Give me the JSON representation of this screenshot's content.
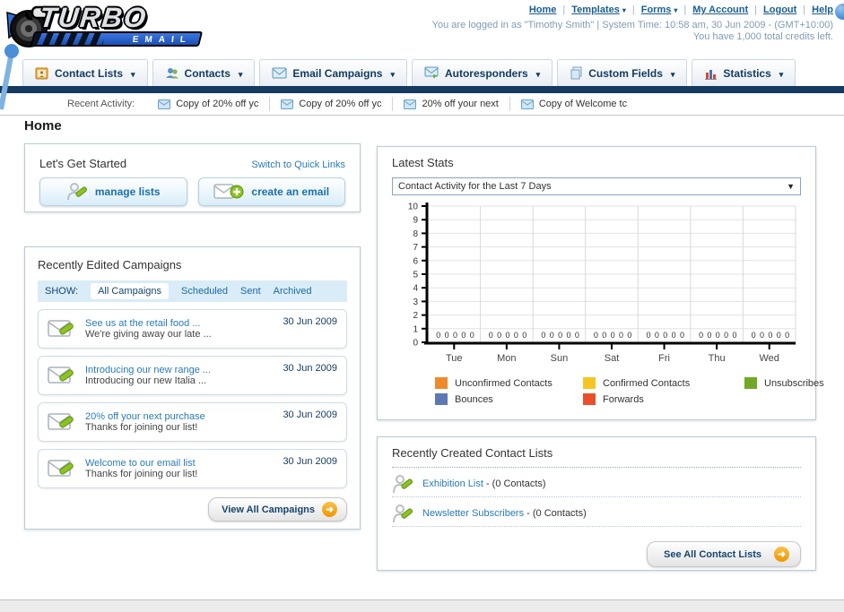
{
  "header": {
    "logo_title": "TURBO",
    "logo_subtitle": "EMAIL",
    "nav_links": [
      {
        "label": "Home",
        "dropdown": false
      },
      {
        "label": "Templates",
        "dropdown": true
      },
      {
        "label": "Forms",
        "dropdown": true
      },
      {
        "label": "My Account",
        "dropdown": false
      },
      {
        "label": "Logout",
        "dropdown": false
      },
      {
        "label": "Help",
        "dropdown": false
      }
    ],
    "login_line": "You are logged in as \"Timothy Smith\" | System Time: 10:58 am, 30 Jun 2009 - (GMT+10:00)",
    "credits_line": "You have 1,000 total credits left."
  },
  "tabs": [
    {
      "label": "Contact Lists"
    },
    {
      "label": "Contacts"
    },
    {
      "label": "Email Campaigns"
    },
    {
      "label": "Autoresponders"
    },
    {
      "label": "Custom Fields"
    },
    {
      "label": "Statistics"
    }
  ],
  "recent_activity": {
    "label": "Recent Activity:",
    "items": [
      {
        "title": "Copy of 20% off yc"
      },
      {
        "title": "Copy of 20% off yc"
      },
      {
        "title": "20% off your next"
      },
      {
        "title": "Copy of Welcome tc"
      }
    ]
  },
  "page": {
    "title": "Home"
  },
  "get_started": {
    "title": "Let's Get Started",
    "switch_link": "Switch to Quick Links",
    "manage_lists_label": "manage lists",
    "create_email_label": "create an email"
  },
  "campaigns": {
    "title": "Recently Edited Campaigns",
    "show_label": "SHOW:",
    "filters": [
      {
        "label": "All Campaigns",
        "selected": true
      },
      {
        "label": "Scheduled",
        "selected": false
      },
      {
        "label": "Sent",
        "selected": false
      },
      {
        "label": "Archived",
        "selected": false
      }
    ],
    "items": [
      {
        "title": "See us at the retail food ...",
        "subtitle": "We're giving away our late ...",
        "date": "30 Jun 2009"
      },
      {
        "title": "Introducing our new range ...",
        "subtitle": "Introducing our new Italia ...",
        "date": "30 Jun 2009"
      },
      {
        "title": "20% off your next purchase",
        "subtitle": "Thanks for joining our list!",
        "date": "30 Jun 2009"
      },
      {
        "title": "Welcome to our email list",
        "subtitle": "Thanks for joining our list!",
        "date": "30 Jun 2009"
      }
    ],
    "view_all_label": "View All Campaigns"
  },
  "stats": {
    "title": "Latest Stats",
    "dropdown_value": "Contact Activity for the Last 7 Days"
  },
  "chart_data": {
    "type": "bar",
    "title": "Contact Activity for the Last 7 Days",
    "categories": [
      "Tue",
      "Mon",
      "Sun",
      "Sat",
      "Fri",
      "Thu",
      "Wed"
    ],
    "series": [
      {
        "name": "Unconfirmed Contacts",
        "color": "#ef8a2a",
        "values": [
          0,
          0,
          0,
          0,
          0,
          0,
          0
        ]
      },
      {
        "name": "Confirmed Contacts",
        "color": "#f5c623",
        "values": [
          0,
          0,
          0,
          0,
          0,
          0,
          0
        ]
      },
      {
        "name": "Unsubscribes",
        "color": "#71a825",
        "values": [
          0,
          0,
          0,
          0,
          0,
          0,
          0
        ]
      },
      {
        "name": "Bounces",
        "color": "#5d79b2",
        "values": [
          0,
          0,
          0,
          0,
          0,
          0,
          0
        ]
      },
      {
        "name": "Forwards",
        "color": "#e8502a",
        "values": [
          0,
          0,
          0,
          0,
          0,
          0,
          0
        ]
      }
    ],
    "ylim": [
      0,
      10
    ],
    "yticks": [
      0,
      1,
      2,
      3,
      4,
      5,
      6,
      7,
      8,
      9,
      10
    ],
    "grid": true,
    "legend_position": "bottom",
    "value_labels_shown": true
  },
  "contact_lists": {
    "title": "Recently Created Contact Lists",
    "items": [
      {
        "name": "Exhibition List",
        "suffix": " - (0 Contacts)"
      },
      {
        "name": "Newsletter Subscribers",
        "suffix": " - (0 Contacts)"
      }
    ],
    "see_all_label": "See All Contact Lists"
  }
}
